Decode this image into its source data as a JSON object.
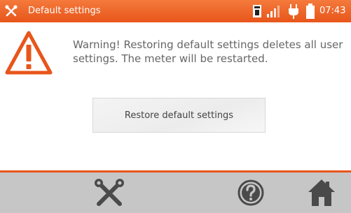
{
  "header": {
    "title": "Default settings",
    "app_icon": "tools-icon",
    "clock": "07:43",
    "status_icons": [
      "memory-card-icon",
      "signal-strength-icon",
      "power-plug-icon",
      "battery-icon"
    ]
  },
  "warning": {
    "icon": "warning-triangle-icon",
    "message": "Warning! Restoring default settings deletes all user settings. The meter will be restarted."
  },
  "actions": {
    "restore_label": "Restore default settings"
  },
  "footer": {
    "buttons": [
      "settings-tools-icon",
      "help-icon",
      "home-icon"
    ]
  },
  "colors": {
    "accent": "#e8551a",
    "footer_bg": "#c6c6c6",
    "icon_dark": "#4a4a4a"
  }
}
